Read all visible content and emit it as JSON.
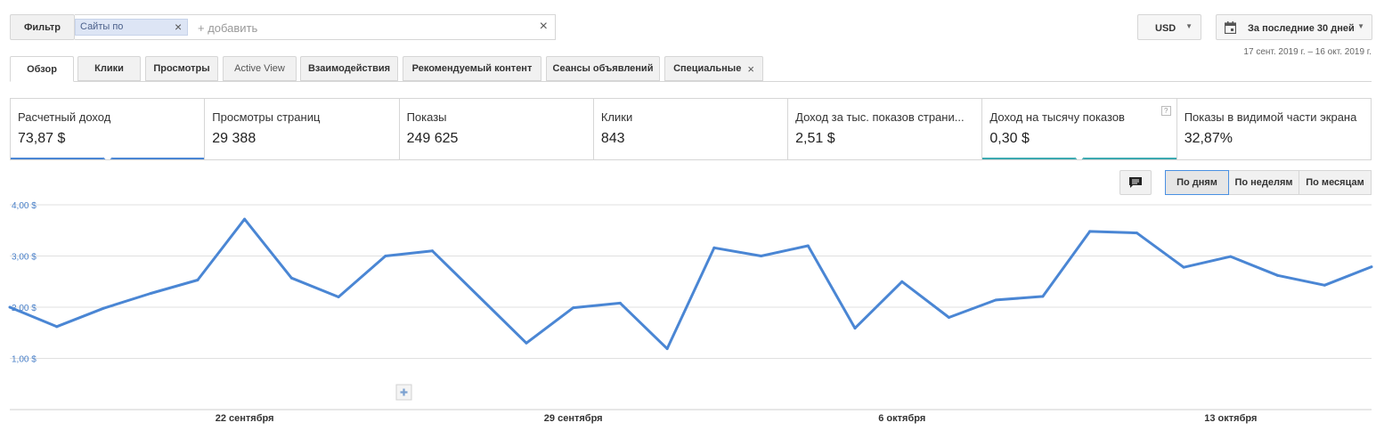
{
  "toolbar": {
    "filter_label": "Фильтр",
    "chip_label": "Сайты по",
    "add_placeholder": "+ добавить",
    "currency": "USD",
    "date_range": "За последние 30 дней",
    "date_range_sub": "17 сент. 2019 г. – 16 окт. 2019 г."
  },
  "tabs": [
    {
      "label": "Обзор"
    },
    {
      "label": "Клики"
    },
    {
      "label": "Просмотры"
    },
    {
      "label": "Active View"
    },
    {
      "label": "Взаимодействия"
    },
    {
      "label": "Рекомендуемый контент"
    },
    {
      "label": "Сеансы объявлений"
    },
    {
      "label": "Специальные"
    }
  ],
  "metrics": [
    {
      "name": "Расчетный доход",
      "value": "73,87 $",
      "color": "#4a86d4"
    },
    {
      "name": "Просмотры страниц",
      "value": "29 388"
    },
    {
      "name": "Показы",
      "value": "249 625"
    },
    {
      "name": "Клики",
      "value": "843"
    },
    {
      "name": "Доход за тыс. показов страни...",
      "value": "2,51 $"
    },
    {
      "name": "Доход на тысячу показов",
      "value": "0,30 $",
      "color": "#3ba9b0",
      "help": "?"
    },
    {
      "name": "Показы в видимой части экрана",
      "value": "32,87%"
    }
  ],
  "period": {
    "days": "По дням",
    "weeks": "По неделям",
    "months": "По месяцам",
    "selected": "days"
  },
  "icons": {
    "comment": "comment-icon",
    "calendar": "calendar-icon",
    "add_annotation": "plus-icon"
  },
  "chart_data": {
    "type": "line",
    "ylim": [
      0,
      4
    ],
    "yticks": [
      "4,00 $",
      "3,00 $",
      "2,00 $",
      "1,00 $"
    ],
    "xticks": [
      "22 сентября",
      "29 сентября",
      "6 октября",
      "13 октября"
    ],
    "series": [
      {
        "color": "#4a86d4",
        "x": [
          "2019-09-17",
          "2019-09-18",
          "2019-09-19",
          "2019-09-20",
          "2019-09-21",
          "2019-09-22",
          "2019-09-23",
          "2019-09-24",
          "2019-09-25",
          "2019-09-26",
          "2019-09-27",
          "2019-09-28",
          "2019-09-29",
          "2019-09-30",
          "2019-10-01",
          "2019-10-02",
          "2019-10-03",
          "2019-10-04",
          "2019-10-05",
          "2019-10-06",
          "2019-10-07",
          "2019-10-08",
          "2019-10-09",
          "2019-10-10",
          "2019-10-11",
          "2019-10-12",
          "2019-10-13",
          "2019-10-14",
          "2019-10-15",
          "2019-10-16"
        ],
        "values": [
          2.0,
          1.62,
          1.98,
          2.27,
          2.53,
          3.72,
          2.57,
          2.2,
          3.0,
          3.1,
          2.2,
          1.3,
          1.99,
          2.08,
          1.19,
          3.16,
          3.0,
          3.2,
          1.59,
          2.5,
          1.8,
          2.14,
          2.21,
          3.48,
          3.45,
          2.78,
          2.99,
          2.62,
          2.43,
          2.79
        ]
      }
    ]
  }
}
